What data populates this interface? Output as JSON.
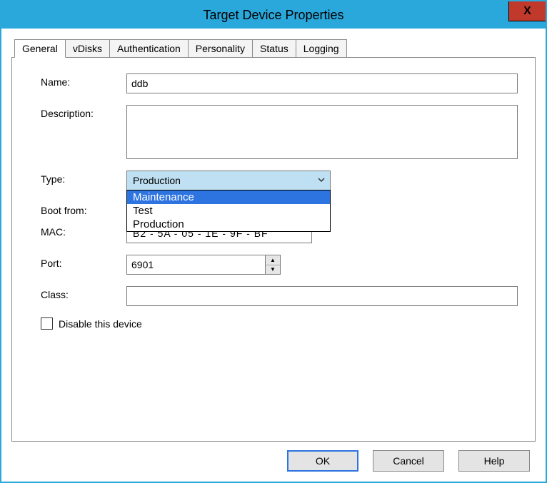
{
  "window": {
    "title": "Target Device Properties",
    "close_glyph": "X"
  },
  "tabs": {
    "t0": "General",
    "t1": "vDisks",
    "t2": "Authentication",
    "t3": "Personality",
    "t4": "Status",
    "t5": "Logging"
  },
  "labels": {
    "name": "Name:",
    "description": "Description:",
    "type": "Type:",
    "boot_from": "Boot from:",
    "mac": "MAC:",
    "port": "Port:",
    "class": "Class:",
    "disable": "Disable this device"
  },
  "values": {
    "name": "ddb",
    "description": "",
    "type_selected": "Production",
    "type_options": {
      "o0": "Maintenance",
      "o1": "Test",
      "o2": "Production"
    },
    "type_highlighted": "Maintenance",
    "mac": "B2 - 5A - 05 - 1E - 9F - BF",
    "port": "6901",
    "class": "",
    "disable_checked": false
  },
  "buttons": {
    "ok": "OK",
    "cancel": "Cancel",
    "help": "Help"
  },
  "icons": {
    "chevron_down": "⌄",
    "spin_up": "▲",
    "spin_down": "▼"
  }
}
